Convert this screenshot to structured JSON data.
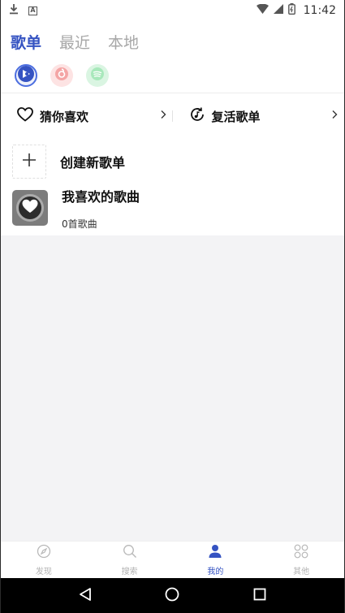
{
  "status_bar": {
    "time": "11:42",
    "notification_a": "A"
  },
  "tabs": [
    {
      "label": "歌单",
      "active": true
    },
    {
      "label": "最近",
      "active": false
    },
    {
      "label": "本地",
      "active": false
    }
  ],
  "platforms": [
    {
      "icon": "app-logo-icon",
      "active": true,
      "color": "#3553c2"
    },
    {
      "icon": "netease-music-icon",
      "active": false,
      "color": "#f28b8b"
    },
    {
      "icon": "spotify-icon",
      "active": false,
      "color": "#7fdc9c"
    }
  ],
  "quick_actions": [
    {
      "label": "猜你喜欢",
      "icon": "heart-outline-icon"
    },
    {
      "label": "复活歌单",
      "icon": "revive-music-icon"
    }
  ],
  "playlists": {
    "create_label": "创建新歌单",
    "liked": {
      "title": "我喜欢的歌曲",
      "subtitle": "0首歌曲"
    }
  },
  "bottom_nav": [
    {
      "label": "发现",
      "icon": "compass-icon",
      "active": false
    },
    {
      "label": "搜索",
      "icon": "search-icon",
      "active": false
    },
    {
      "label": "我的",
      "icon": "person-icon",
      "active": true
    },
    {
      "label": "其他",
      "icon": "grid-icon",
      "active": false
    }
  ],
  "colors": {
    "accent": "#3553c2",
    "inactive": "#b3b3b3",
    "background_gray": "#f3f3f5"
  }
}
